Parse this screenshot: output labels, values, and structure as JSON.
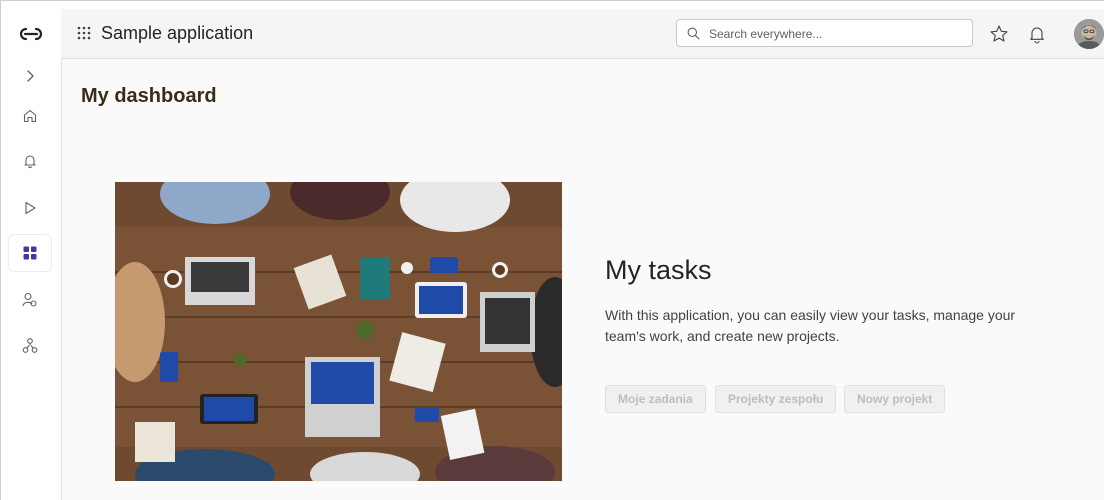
{
  "app": {
    "title": "Sample application"
  },
  "search": {
    "placeholder": "Search everywhere..."
  },
  "rail": {
    "items": [
      {
        "icon": "chevron-right-icon"
      },
      {
        "icon": "home-icon"
      },
      {
        "icon": "bell-icon"
      },
      {
        "icon": "play-icon"
      },
      {
        "icon": "apps-grid-icon",
        "active": true
      },
      {
        "icon": "people-icon"
      },
      {
        "icon": "org-icon"
      }
    ]
  },
  "page": {
    "title": "My dashboard"
  },
  "hero": {
    "title": "My tasks",
    "description": "With this application, you can easily view your tasks, manage your team's work, and create new projects.",
    "buttons": [
      "Moje zadania",
      "Projekty zespołu",
      "Nowy projekt"
    ]
  },
  "colors": {
    "accent": "#3b3aa8",
    "topbar_bg": "#f5f5f5",
    "main_bg": "#fafafa",
    "title_brown": "#3a2c1a"
  }
}
